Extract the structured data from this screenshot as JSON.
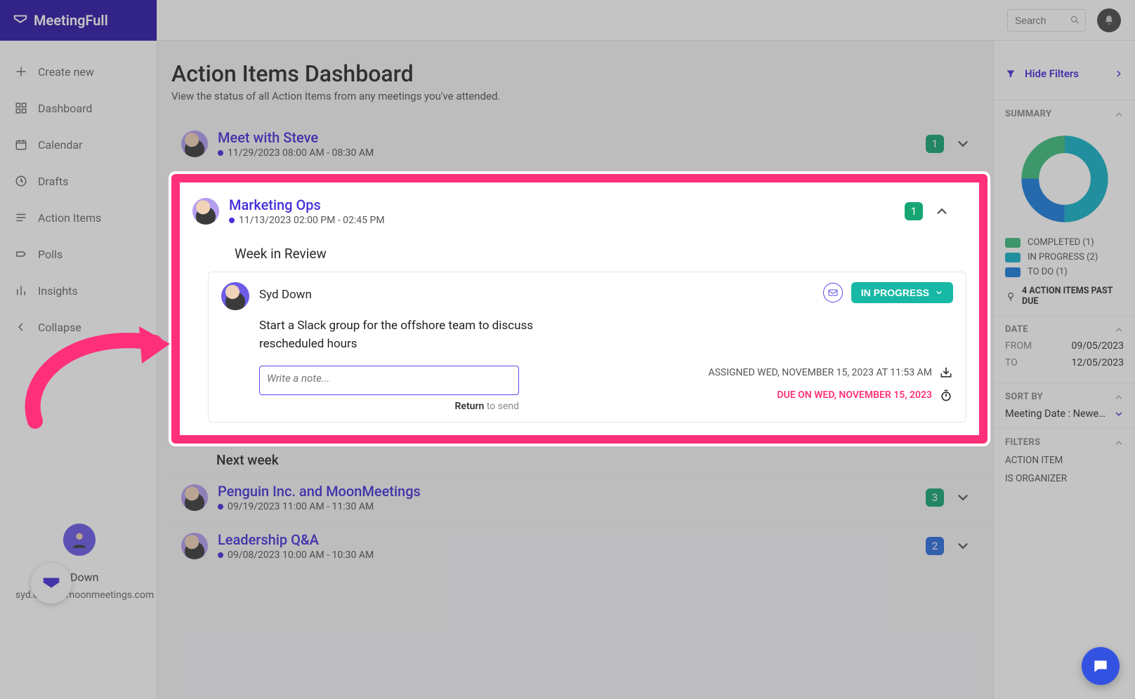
{
  "brand": "MeetingFull",
  "topbar": {
    "search_placeholder": "Search",
    "bell_label": "Notifications"
  },
  "sidebar": {
    "items": [
      {
        "icon": "plus",
        "label": "Create new"
      },
      {
        "icon": "dashboard",
        "label": "Dashboard"
      },
      {
        "icon": "calendar",
        "label": "Calendar"
      },
      {
        "icon": "clock",
        "label": "Drafts"
      },
      {
        "icon": "list",
        "label": "Action Items"
      },
      {
        "icon": "polls",
        "label": "Polls"
      },
      {
        "icon": "insights",
        "label": "Insights"
      },
      {
        "icon": "collapse",
        "label": "Collapse"
      }
    ],
    "user_name": "Down",
    "user_email": "syd.down@moonmeetings.com"
  },
  "page": {
    "title": "Action Items Dashboard",
    "subtitle": "View the status of all Action Items from any meetings you've attended."
  },
  "meetings": [
    {
      "title": "Meet with Steve",
      "time": "11/29/2023 08:00 AM - 08:30 AM",
      "count": "1",
      "count_color": "green",
      "expanded": false
    },
    {
      "title": "Marketing Ops",
      "time": "11/13/2023 02:00 PM - 02:45 PM",
      "count": "1",
      "count_color": "green",
      "expanded": true,
      "topic": "Week in Review",
      "action": {
        "assignee": "Syd Down",
        "body": "Start a Slack group for the offshore team to discuss rescheduled hours",
        "status": "IN PROGRESS",
        "note_placeholder": "Write a note...",
        "note_hint_bold": "Return",
        "note_hint_rest": " to send",
        "assigned": "ASSIGNED WED, NOVEMBER 15, 2023 AT 11:53 AM",
        "due": "DUE ON WED, NOVEMBER 15, 2023"
      },
      "next_section": "Next week"
    },
    {
      "title": "Penguin Inc. and MoonMeetings",
      "time": "09/19/2023 11:00 AM - 11:30 AM",
      "count": "3",
      "count_color": "green",
      "expanded": false
    },
    {
      "title": "Leadership Q&A",
      "time": "09/08/2023 10:00 AM - 10:30 AM",
      "count": "2",
      "count_color": "blue",
      "expanded": false
    }
  ],
  "filters": {
    "hide_label": "Hide Filters",
    "summary_label": "SUMMARY",
    "legend": [
      {
        "color": "#3fbf7f",
        "label": "COMPLETED (1)"
      },
      {
        "color": "#18b4c9",
        "label": "IN PROGRESS (2)"
      },
      {
        "color": "#1e7fe0",
        "label": "TO DO (1)"
      }
    ],
    "past_due": "4 ACTION ITEMS PAST DUE",
    "date_label": "DATE",
    "date_from_label": "FROM",
    "date_from": "09/05/2023",
    "date_to_label": "TO",
    "date_to": "12/05/2023",
    "sort_label": "SORT BY",
    "sort_value": "Meeting Date : Newe…",
    "filters_label": "FILTERS",
    "filter_items": [
      "ACTION ITEM",
      "IS ORGANIZER"
    ]
  },
  "chart_data": {
    "type": "pie",
    "title": "",
    "series": [
      {
        "name": "COMPLETED",
        "value": 1,
        "color": "#3fbf7f"
      },
      {
        "name": "IN PROGRESS",
        "value": 2,
        "color": "#18b4c9"
      },
      {
        "name": "TO DO",
        "value": 1,
        "color": "#1e7fe0"
      }
    ]
  }
}
